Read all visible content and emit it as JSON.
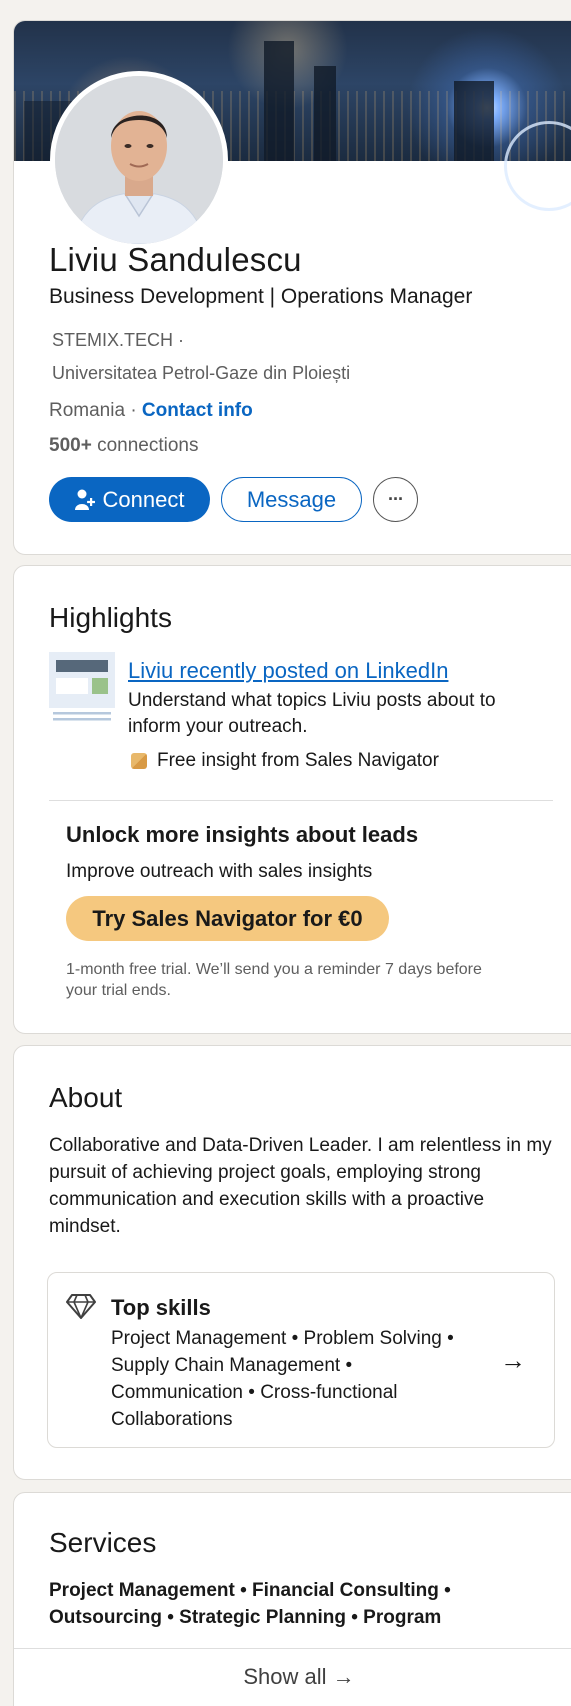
{
  "profile": {
    "name": "Liviu Sandulescu",
    "headline": "Business Development | Operations Manager",
    "company": "STEMIX.TECH  ·",
    "school": "Universitatea Petrol-Gaze din Ploiești",
    "location": "Romania · ",
    "contact_info_label": "Contact info",
    "connections_count": "500+",
    "connections_label": " connections",
    "buttons": {
      "connect": "Connect",
      "message": "Message",
      "more": "···"
    }
  },
  "highlights": {
    "title": "Highlights",
    "post_link": "Liviu recently posted on LinkedIn",
    "post_description": "Understand what topics Liviu posts about to inform your outreach.",
    "insight_label": "Free insight from Sales Navigator",
    "unlock_title": "Unlock more insights about leads",
    "unlock_subtitle": "Improve outreach with sales insights",
    "sales_button": "Try Sales Navigator for €0",
    "trial_note": "1-month free trial. We’ll send you a reminder 7 days before your trial ends."
  },
  "about": {
    "title": "About",
    "text": "Collaborative and Data-Driven Leader. I am relentless in my pursuit of achieving project goals, employing strong communication and execution skills with a proactive mindset.",
    "top_skills_title": "Top skills",
    "top_skills": "Project Management • Problem Solving • Supply Chain Management • Communication • Cross-functional Collaborations",
    "arrow": "→"
  },
  "services": {
    "title": "Services",
    "list": "Project Management • Financial Consulting • Outsourcing • Strategic Planning • Program Management",
    "show_all": "Show all →"
  },
  "colors": {
    "brand_blue": "#0a66c2",
    "sales_gold": "#f5c87f",
    "page_bg": "#f4f2ee"
  },
  "icons": {
    "connect": "person-add-icon",
    "more": "ellipsis-icon",
    "skills": "diamond-icon",
    "insight": "sales-navigator-icon"
  }
}
